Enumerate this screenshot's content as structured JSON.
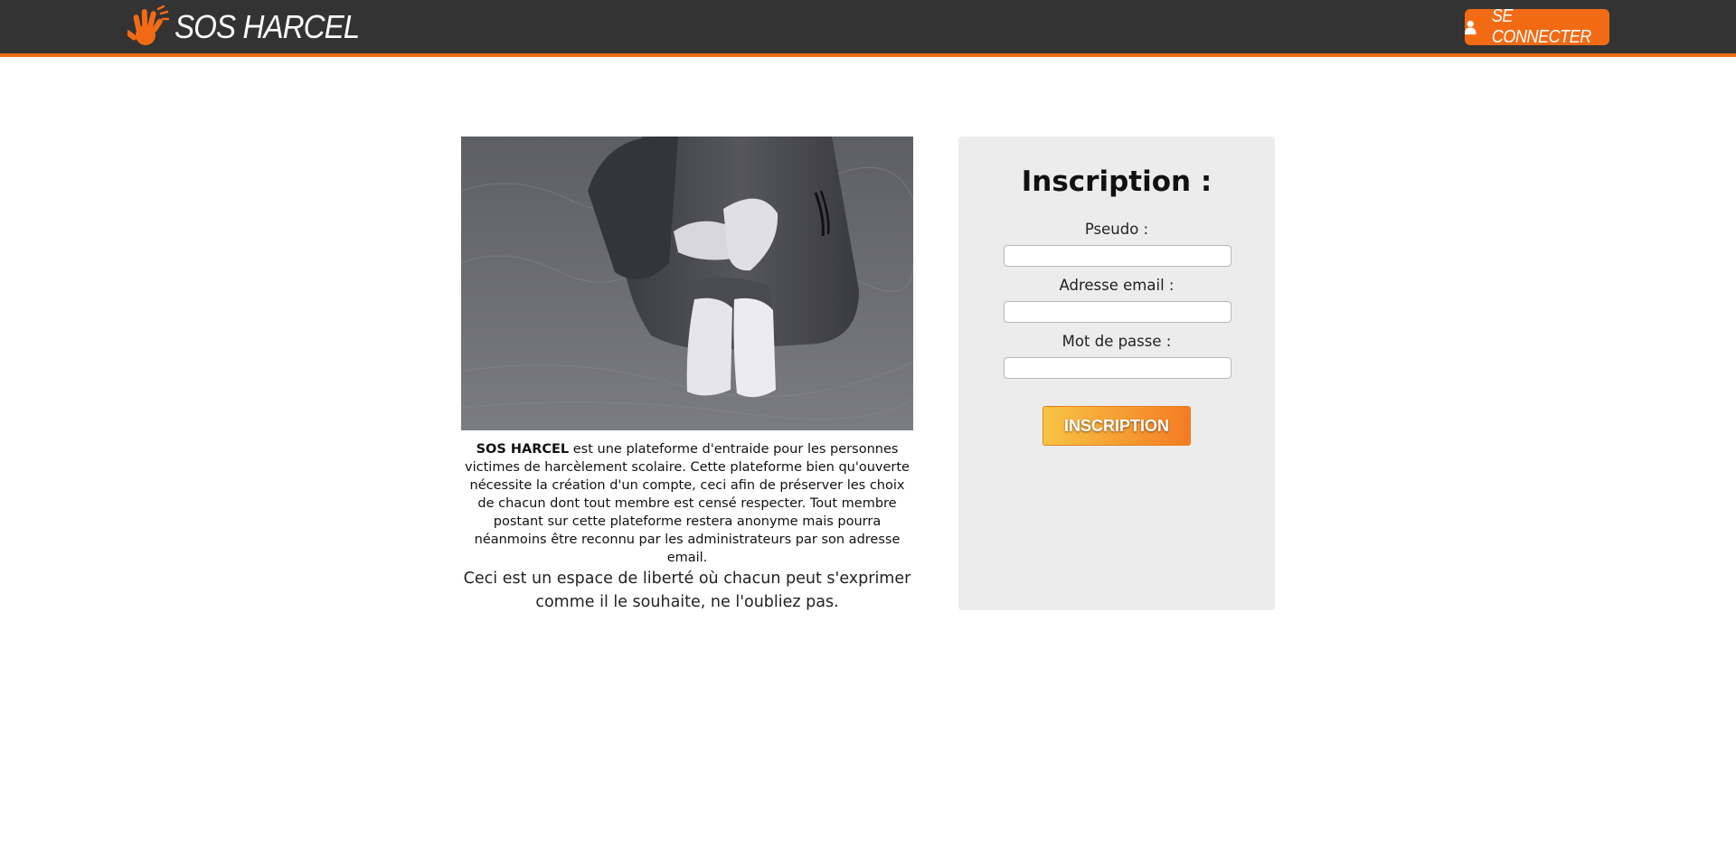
{
  "header": {
    "brand_name": "SOS HARCEL",
    "login_label": "SE CONNECTER",
    "logo_icon": "hand-print-icon",
    "user_icon": "user-icon"
  },
  "colors": {
    "accent": "#f26b14",
    "header_bg": "#333333",
    "panel_bg": "#ececec",
    "button_gradient_start": "#f8c444",
    "button_gradient_end": "#f57c24"
  },
  "intro": {
    "image_subject": "black-and-white photo of a person sitting hugging knees",
    "brand_strong": "SOS HARCEL",
    "description": " est une plateforme d'entraide pour les personnes victimes de harcèlement scolaire. Cette plateforme bien qu'ouverte nécessite la création d'un compte, ceci afin de préserver les choix de chacun dont tout membre est censé respecter. Tout membre postant sur cette plateforme restera anonyme mais pourra néanmoins être reconnu par les administrateurs par son adresse email.",
    "motto": "Ceci est un espace de liberté où chacun peut s'exprimer comme il le souhaite, ne l'oubliez pas."
  },
  "signup": {
    "title": "Inscription :",
    "pseudo_label": "Pseudo :",
    "pseudo_value": "",
    "email_label": "Adresse email :",
    "email_value": "",
    "password_label": "Mot de passe :",
    "password_value": "",
    "submit_label": "INSCRIPTION"
  }
}
